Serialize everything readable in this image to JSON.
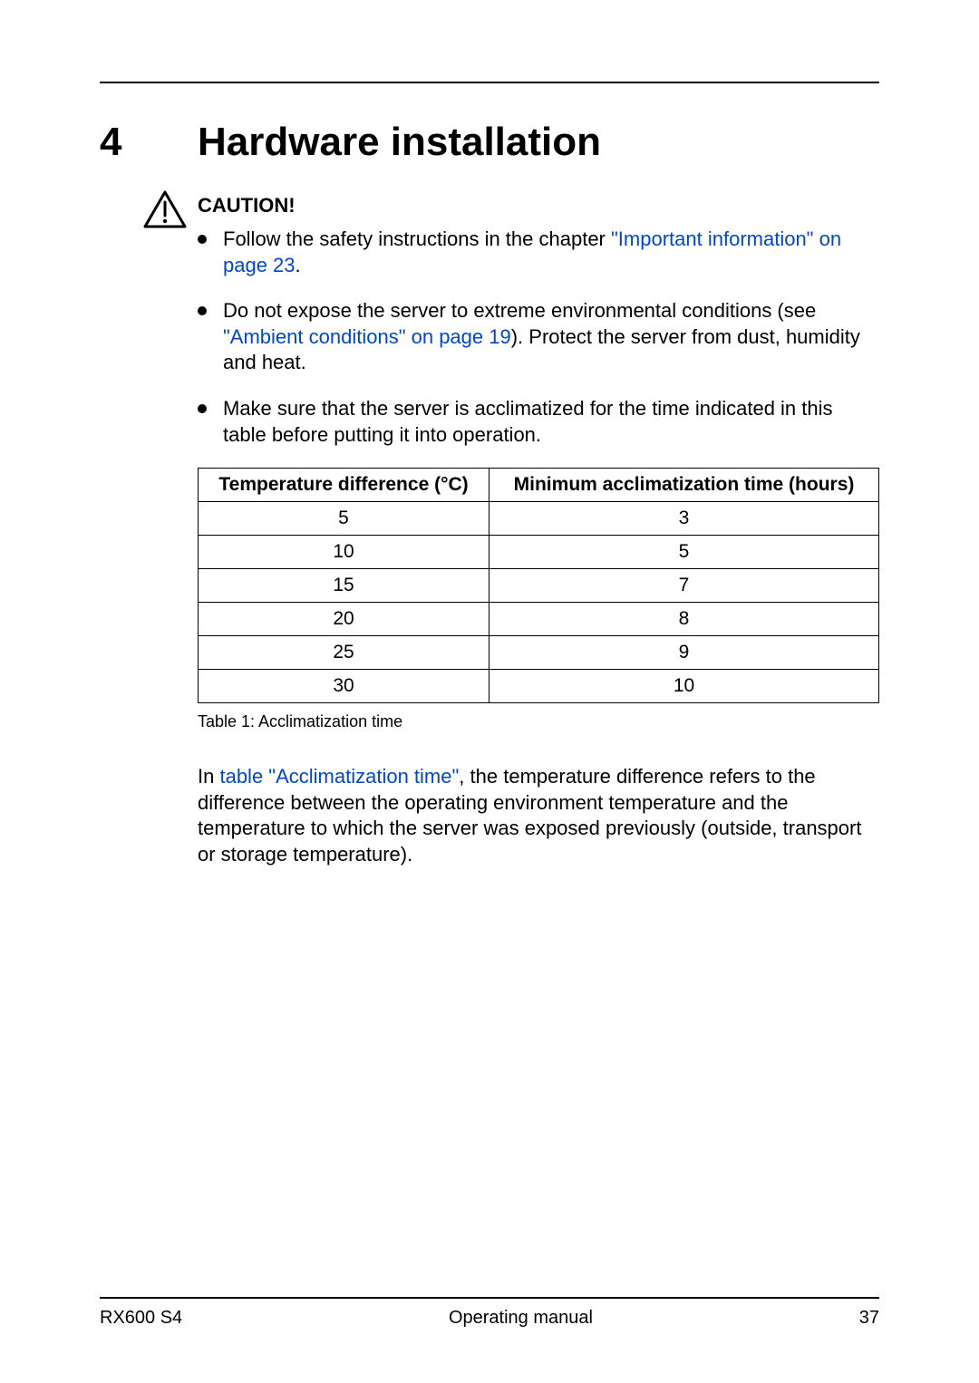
{
  "chapter": {
    "number": "4",
    "title": "Hardware installation"
  },
  "caution": {
    "heading": "CAUTION!",
    "bullets": {
      "b1_a": "Follow the safety instructions in the chapter ",
      "b1_link": "\"Important information\" on page 23",
      "b1_b": ".",
      "b2_a": "Do not expose the server to extreme environmental conditions (see ",
      "b2_link": "\"Ambient conditions\" on page 19",
      "b2_b": "). Protect the server from dust, humidity and heat.",
      "b3": "Make sure that the server is acclimatized for the time indicated in this table before putting it into operation."
    }
  },
  "table": {
    "header_col1": "Temperature difference (°C)",
    "header_col2": "Minimum acclimatization time (hours)",
    "rows": [
      {
        "c1": "5",
        "c2": "3"
      },
      {
        "c1": "10",
        "c2": "5"
      },
      {
        "c1": "15",
        "c2": "7"
      },
      {
        "c1": "20",
        "c2": "8"
      },
      {
        "c1": "25",
        "c2": "9"
      },
      {
        "c1": "30",
        "c2": "10"
      }
    ],
    "caption": "Table 1: Acclimatization time"
  },
  "explain": {
    "a": "In ",
    "link": "table \"Acclimatization time\"",
    "b": ", the temperature difference refers to the difference between the operating environment temperature and the temperature to which the server was exposed previously (outside, transport or storage temperature)."
  },
  "footer": {
    "left": "RX600 S4",
    "center": "Operating manual",
    "right": "37"
  }
}
